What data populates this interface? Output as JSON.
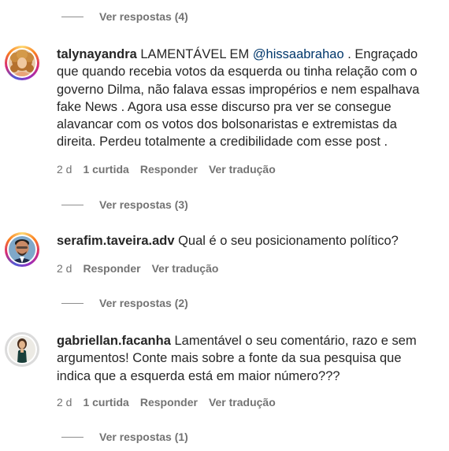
{
  "replies_toggles": [
    {
      "label": "Ver respostas (4)"
    },
    {
      "label": "Ver respostas (3)"
    },
    {
      "label": "Ver respostas (2)"
    },
    {
      "label": "Ver respostas (1)"
    }
  ],
  "comments": [
    {
      "username": "talynayandra",
      "text_before_mention": " LAMENTÁVEL EM ",
      "mention": "@hissaabrahao",
      "text_after_mention": " . Engraçado que quando recebia votos da esquerda ou tinha relação com o governo Dilma, não falava essas impropérios e nem espalhava fake News . Agora usa esse discurso pra ver se consegue alavancar com os votos dos bolsonaristas e extremistas da direita. Perdeu totalmente a credibilidade com esse post .",
      "time": "2 d",
      "likes": "1 curtida",
      "reply": "Responder",
      "translate": "Ver tradução",
      "avatar_icon": "profile-photo-woman-curly-hair",
      "has_story_ring": true
    },
    {
      "username": "serafim.taveira.adv",
      "text": " Qual é o seu posicionamento político?",
      "time": "2 d",
      "reply": "Responder",
      "translate": "Ver tradução",
      "avatar_icon": "profile-photo-man",
      "has_story_ring": true
    },
    {
      "username": "gabriellan.facanha",
      "text": " Lamentável o seu comentário, razo e sem argumentos! Conte mais sobre a fonte da sua pesquisa que indica que a esquerda está em maior número???",
      "time": "2 d",
      "likes": "1 curtida",
      "reply": "Responder",
      "translate": "Ver tradução",
      "avatar_icon": "profile-photo-woman-standing",
      "has_story_ring": false
    }
  ],
  "colors": {
    "text": "#262626",
    "secondary": "#737373",
    "mention": "#00376b"
  }
}
